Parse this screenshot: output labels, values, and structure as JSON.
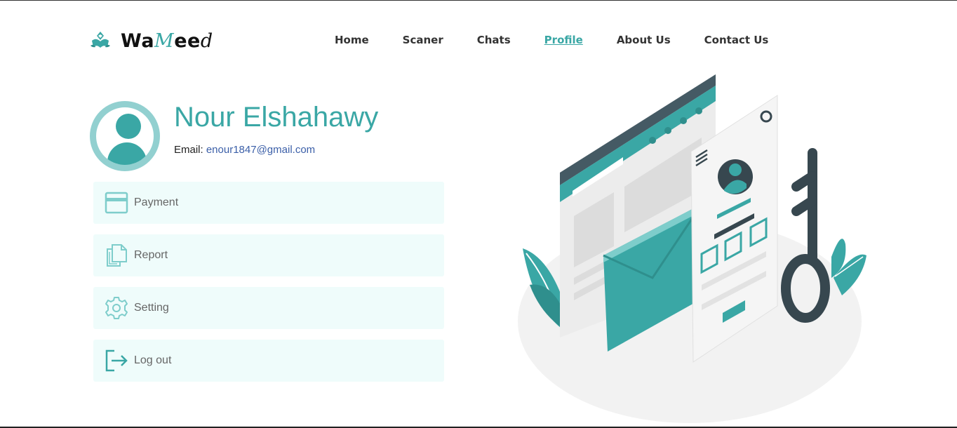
{
  "brand": {
    "name_prefix": "Wa",
    "name_m": "M",
    "name_mid": "ee",
    "name_end": "d",
    "logo_icon": "palm-book-logo"
  },
  "nav": [
    {
      "label": "Home",
      "active": false
    },
    {
      "label": "Scaner",
      "active": false
    },
    {
      "label": "Chats",
      "active": false
    },
    {
      "label": "Profile",
      "active": true
    },
    {
      "label": "About Us",
      "active": false
    },
    {
      "label": "Contact Us",
      "active": false
    }
  ],
  "profile": {
    "name": "Nour Elshahawy",
    "email_label": "Email: ",
    "email": "enour1847@gmail.com",
    "avatar_icon": "user-avatar-icon"
  },
  "menu": [
    {
      "label": "Payment",
      "icon": "credit-card-icon"
    },
    {
      "label": "Report",
      "icon": "documents-icon"
    },
    {
      "label": "Setting",
      "icon": "gear-icon"
    },
    {
      "label": "Log out",
      "icon": "logout-icon"
    }
  ],
  "colors": {
    "accent": "#3aa7a5",
    "accent_light": "#92d0d0",
    "menu_bg": "#effcfb",
    "email": "#3b5fa8",
    "dark": "#37474f"
  }
}
